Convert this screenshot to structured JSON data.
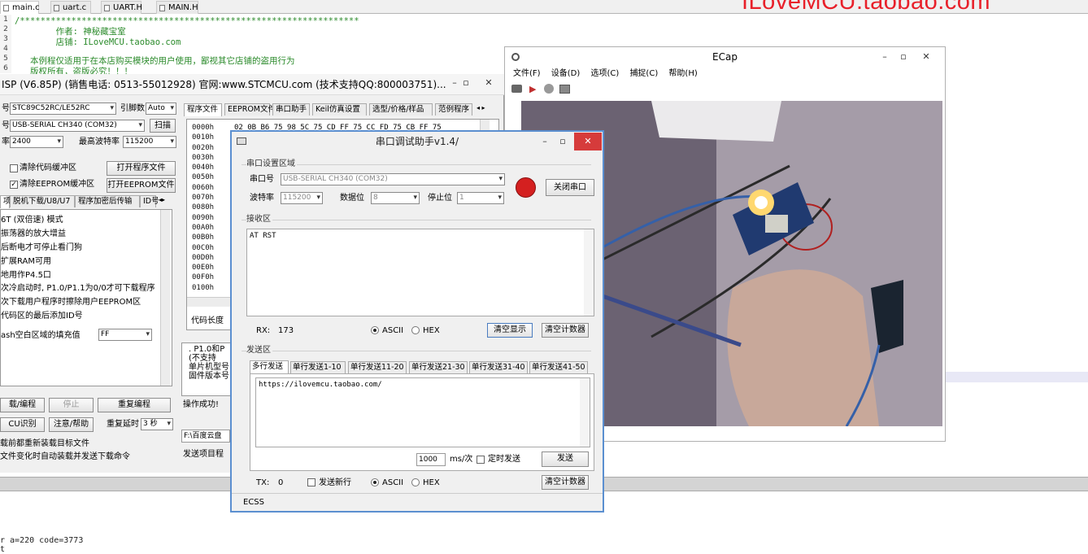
{
  "editor": {
    "tabs": [
      "main.c",
      "uart.c",
      "UART.H",
      "MAIN.H"
    ],
    "line_numbers": [
      "1",
      "2",
      "3",
      "4",
      "5",
      "6"
    ],
    "code_lines": [
      "/******************************************************************",
      "        作者: 神秘藏宝室",
      "        店铺: ILoveMCU.taobao.com",
      "",
      "   本例程仅适用于在本店购买模块的用户使用，鄙视其它店铺的盗用行为",
      "   版权所有，盗版必究！！！"
    ],
    "watermark": "ILoveMCU.taobao.com",
    "output_lines": [
      "r a=220 code=3773",
      "t"
    ]
  },
  "isp": {
    "title": "ISP (V6.85P) (销售电话: 0513-55012928) 官网:www.STCMCU.com (技术支持QQ:800003751)...",
    "mcu_label": "号",
    "mcu_value": "STC89C52RC/LE52RC",
    "pin_label": "引脚数",
    "pin_value": "Auto",
    "port_label": "号",
    "port_value": "USB-SERIAL CH340 (COM32)",
    "scan_btn": "扫描",
    "baud_label": "率",
    "baud_value": "2400",
    "maxbaud_label": "最高波特率",
    "maxbaud_value": "115200",
    "clear_code": "清除代码缓冲区",
    "open_prog": "打开程序文件",
    "clear_eeprom": "清除EEPROM缓冲区",
    "open_eeprom": "打开EEPROM文件",
    "left_tabs": [
      "项",
      "脱机下载/U8/U7",
      "程序加密后传输",
      "ID号"
    ],
    "options": [
      "6T (双倍速) 模式",
      "振荡器的放大增益",
      "后断电才可停止看门狗",
      "扩展RAM可用",
      "地用作P4.5口",
      "次冷启动时, P1.0/P1.1为0/0才可下载程序",
      "次下载用户程序时擦除用户EEPROM区",
      "代码区的最后添加ID号"
    ],
    "fill_label": "ash空白区域的填充值",
    "fill_value": "FF",
    "right_tabs": [
      "程序文件",
      "EEPROM文件",
      "串口助手",
      "Keil仿真设置",
      "选型/价格/样品",
      "范例程序"
    ],
    "hex_addrs": [
      "0000h",
      "0010h",
      "0020h",
      "0030h",
      "0040h",
      "0050h",
      "0060h",
      "0070h",
      "0080h",
      "0090h",
      "00A0h",
      "00B0h",
      "00C0h",
      "00D0h",
      "00E0h",
      "00F0h",
      "0100h"
    ],
    "hex_first": "02 0B B6 75 98 5C 75 CD FF 75 CC FD 75 CB FF 75",
    "code_label": "代码长度",
    "log_lines": [
      ". P1.0和P",
      "(不支持",
      "单片机型号",
      "固件版本号"
    ],
    "op_done": "操作成功!",
    "path": "F:\\百度云盘",
    "send_proj": "发送项目程",
    "download_btn": "载/编程",
    "stop_btn": "停止",
    "reprog_btn": "重复编程",
    "check_btn": "CU识别",
    "help_btn": "注意/帮助",
    "delay_label": "重复延时",
    "delay_value": "3 秒",
    "reload_text": "载前都重新装载目标文件",
    "auto_text": "文件变化时自动装载并发送下载命令"
  },
  "serial": {
    "title": "串口调试助手v1.4/",
    "settings_group": "串口设置区域",
    "port_label": "串口号",
    "port_value": "USB-SERIAL CH340 (COM32)",
    "close_btn": "关闭串口",
    "baud_label": "波特率",
    "baud_value": "115200",
    "data_label": "数据位",
    "data_value": "8",
    "stop_label": "停止位",
    "stop_value": "1",
    "recv_group": "接收区",
    "recv_text": "AT RST",
    "rx_label": "RX:",
    "rx_value": "173",
    "ascii": "ASCII",
    "hex": "HEX",
    "clear_btn": "清空显示",
    "clear_count_btn": "清空计数器",
    "send_group": "发送区",
    "send_tabs": [
      "多行发送",
      "单行发送1-10",
      "单行发送11-20",
      "单行发送21-30",
      "单行发送31-40",
      "单行发送41-50"
    ],
    "send_text": "https://ilovemcu.taobao.com/",
    "interval_value": "1000",
    "interval_unit": "ms/次",
    "timer_label": "定时发送",
    "send_btn": "发送",
    "tx_label": "TX:",
    "tx_value": "0",
    "newline_label": "发送新行",
    "clear_count_btn2": "清空计数器",
    "status": "ECSS"
  },
  "ecap": {
    "title": "ECap",
    "menu": [
      "文件(F)",
      "设备(D)",
      "选项(C)",
      "捕捉(C)",
      "帮助(H)"
    ]
  }
}
